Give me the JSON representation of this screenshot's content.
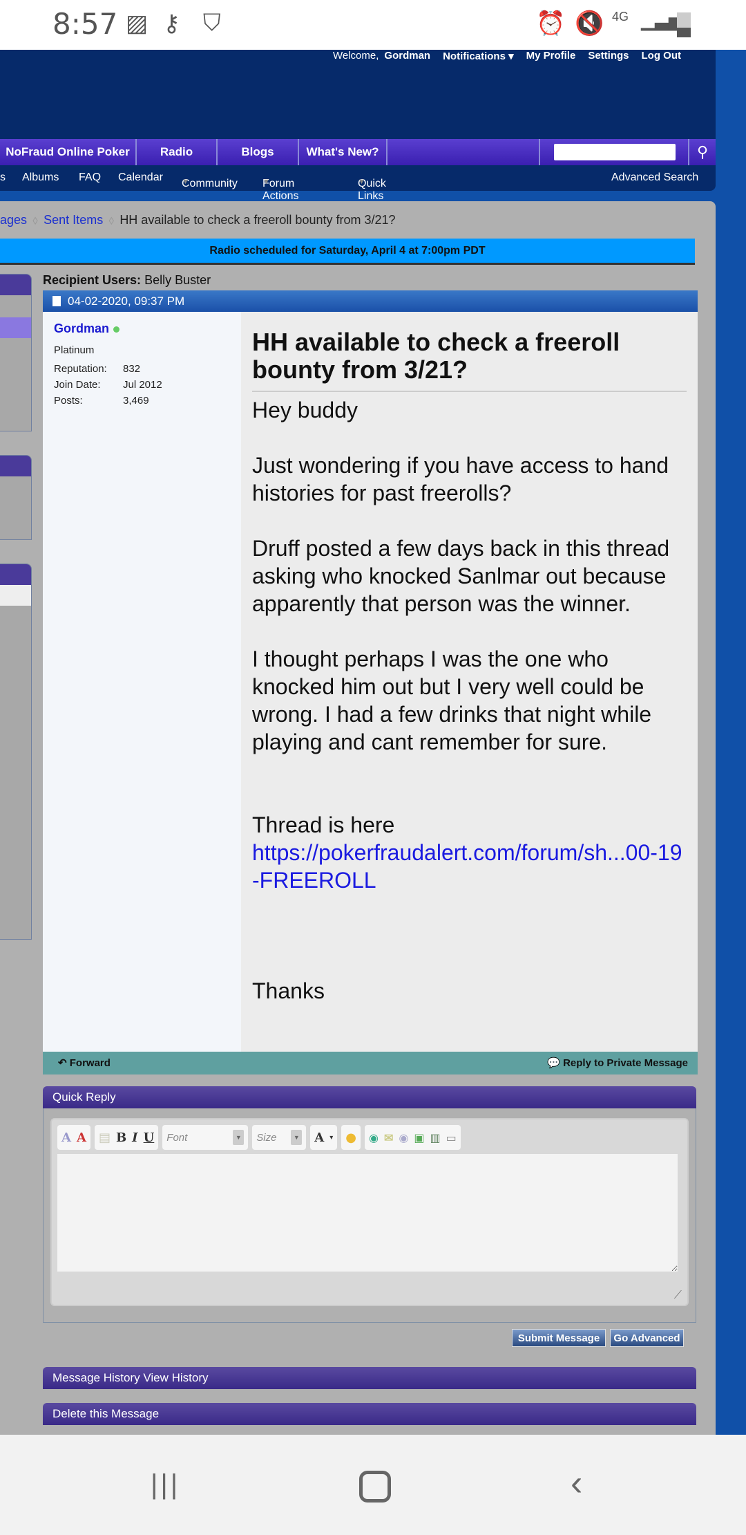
{
  "status_bar": {
    "time": "8:57",
    "network": "4G"
  },
  "header": {
    "welcome": "Welcome,",
    "username": "Gordman",
    "notifications": "Notifications",
    "my_profile": "My Profile",
    "settings": "Settings",
    "log_out": "Log Out"
  },
  "main_nav": {
    "tabs": [
      "NoFraud Online Poker",
      "Radio",
      "Blogs",
      "What's New?"
    ],
    "search_placeholder": ""
  },
  "sub_nav": {
    "items": [
      "s",
      "Albums",
      "FAQ",
      "Calendar",
      "Community",
      "Forum Actions",
      "Quick Links"
    ],
    "advanced_search": "Advanced Search"
  },
  "breadcrumb": {
    "items": [
      "ages",
      "Sent Items"
    ],
    "current": "HH available to check a freeroll bounty from 3/21?"
  },
  "announcement": "Radio scheduled for Saturday, April 4 at 7:00pm PDT",
  "message": {
    "recipient_label": "Recipient Users:",
    "recipient": "Belly Buster",
    "date": "04-02-2020, 09:37 PM",
    "author": {
      "name": "Gordman",
      "title": "Platinum",
      "reputation_label": "Reputation:",
      "reputation": "832",
      "join_label": "Join Date:",
      "join": "Jul 2012",
      "posts_label": "Posts:",
      "posts": "3,469"
    },
    "title": "HH available to check a freeroll bounty from 3/21?",
    "paragraphs": [
      "Hey buddy",
      "Just wondering if you have access to hand histories for past freerolls?",
      "Druff posted a few days back in this thread asking who knocked Sanlmar out because apparently that person was the winner.",
      "I thought perhaps I was the one who knocked him out but I very well could be wrong. I had a few drinks that night while playing and cant remember for sure."
    ],
    "thread_label": "Thread is here",
    "thread_link": "https://pokerfraudalert.com/forum/sh...00-19-FREEROLL",
    "closing": "Thanks",
    "forward": "Forward",
    "reply": "Reply to Private Message"
  },
  "quick_reply": {
    "title": "Quick Reply",
    "font": "Font",
    "size": "Size",
    "submit": "Submit Message",
    "advanced": "Go Advanced"
  },
  "history": "Message History View History",
  "delete": "Delete this Message",
  "colors": {
    "nav": "#4a30c0",
    "header": "#062a6a",
    "banner": "#0099ff",
    "footer": "#5fa0a0"
  }
}
